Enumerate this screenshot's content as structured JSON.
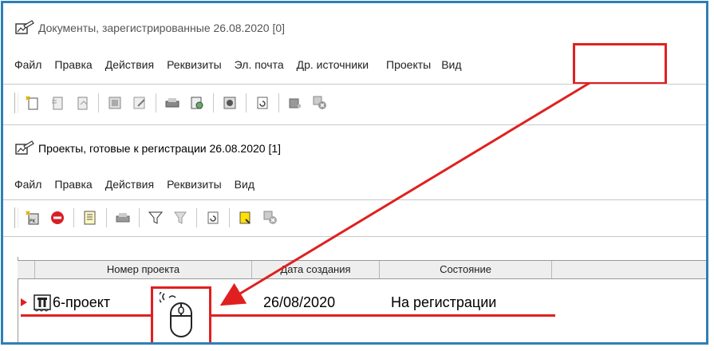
{
  "window1": {
    "title": "Документы, зарегистрированные 26.08.2020  [0]",
    "menu": [
      "Файл",
      "Правка",
      "Действия",
      "Реквизиты",
      "Эл. почта",
      "Др. источники"
    ],
    "menu_highlight": "Проекты",
    "menu_last": "Вид",
    "toolbar_icons": [
      "new-document-icon",
      "new-incoming-icon",
      "new-outgoing-icon",
      "card-icon",
      "edit-card-icon",
      "print-icon",
      "print-preview-icon",
      "register-icon",
      "refresh-icon",
      "report-icon",
      "delete-icon"
    ]
  },
  "window2": {
    "title": "Проекты, готовые к регистрации 26.08.2020  [1]",
    "menu": [
      "Файл",
      "Правка",
      "Действия",
      "Реквизиты",
      "Вид"
    ],
    "toolbar_icons": [
      "new-project-icon",
      "stop-icon",
      "card-icon",
      "print-icon",
      "filter-icon",
      "filter-off-icon",
      "refresh-icon",
      "note-icon",
      "delete-icon"
    ]
  },
  "grid": {
    "columns": [
      "Номер проекта",
      "Дата создания",
      "Состояние"
    ],
    "rows": [
      {
        "number": "6-проект",
        "date": "26/08/2020",
        "state": "На регистрации"
      }
    ]
  },
  "annotation": {
    "color": "#e02020",
    "frame_color": "#2f7fb5",
    "icon": "mouse-double-click-icon"
  }
}
